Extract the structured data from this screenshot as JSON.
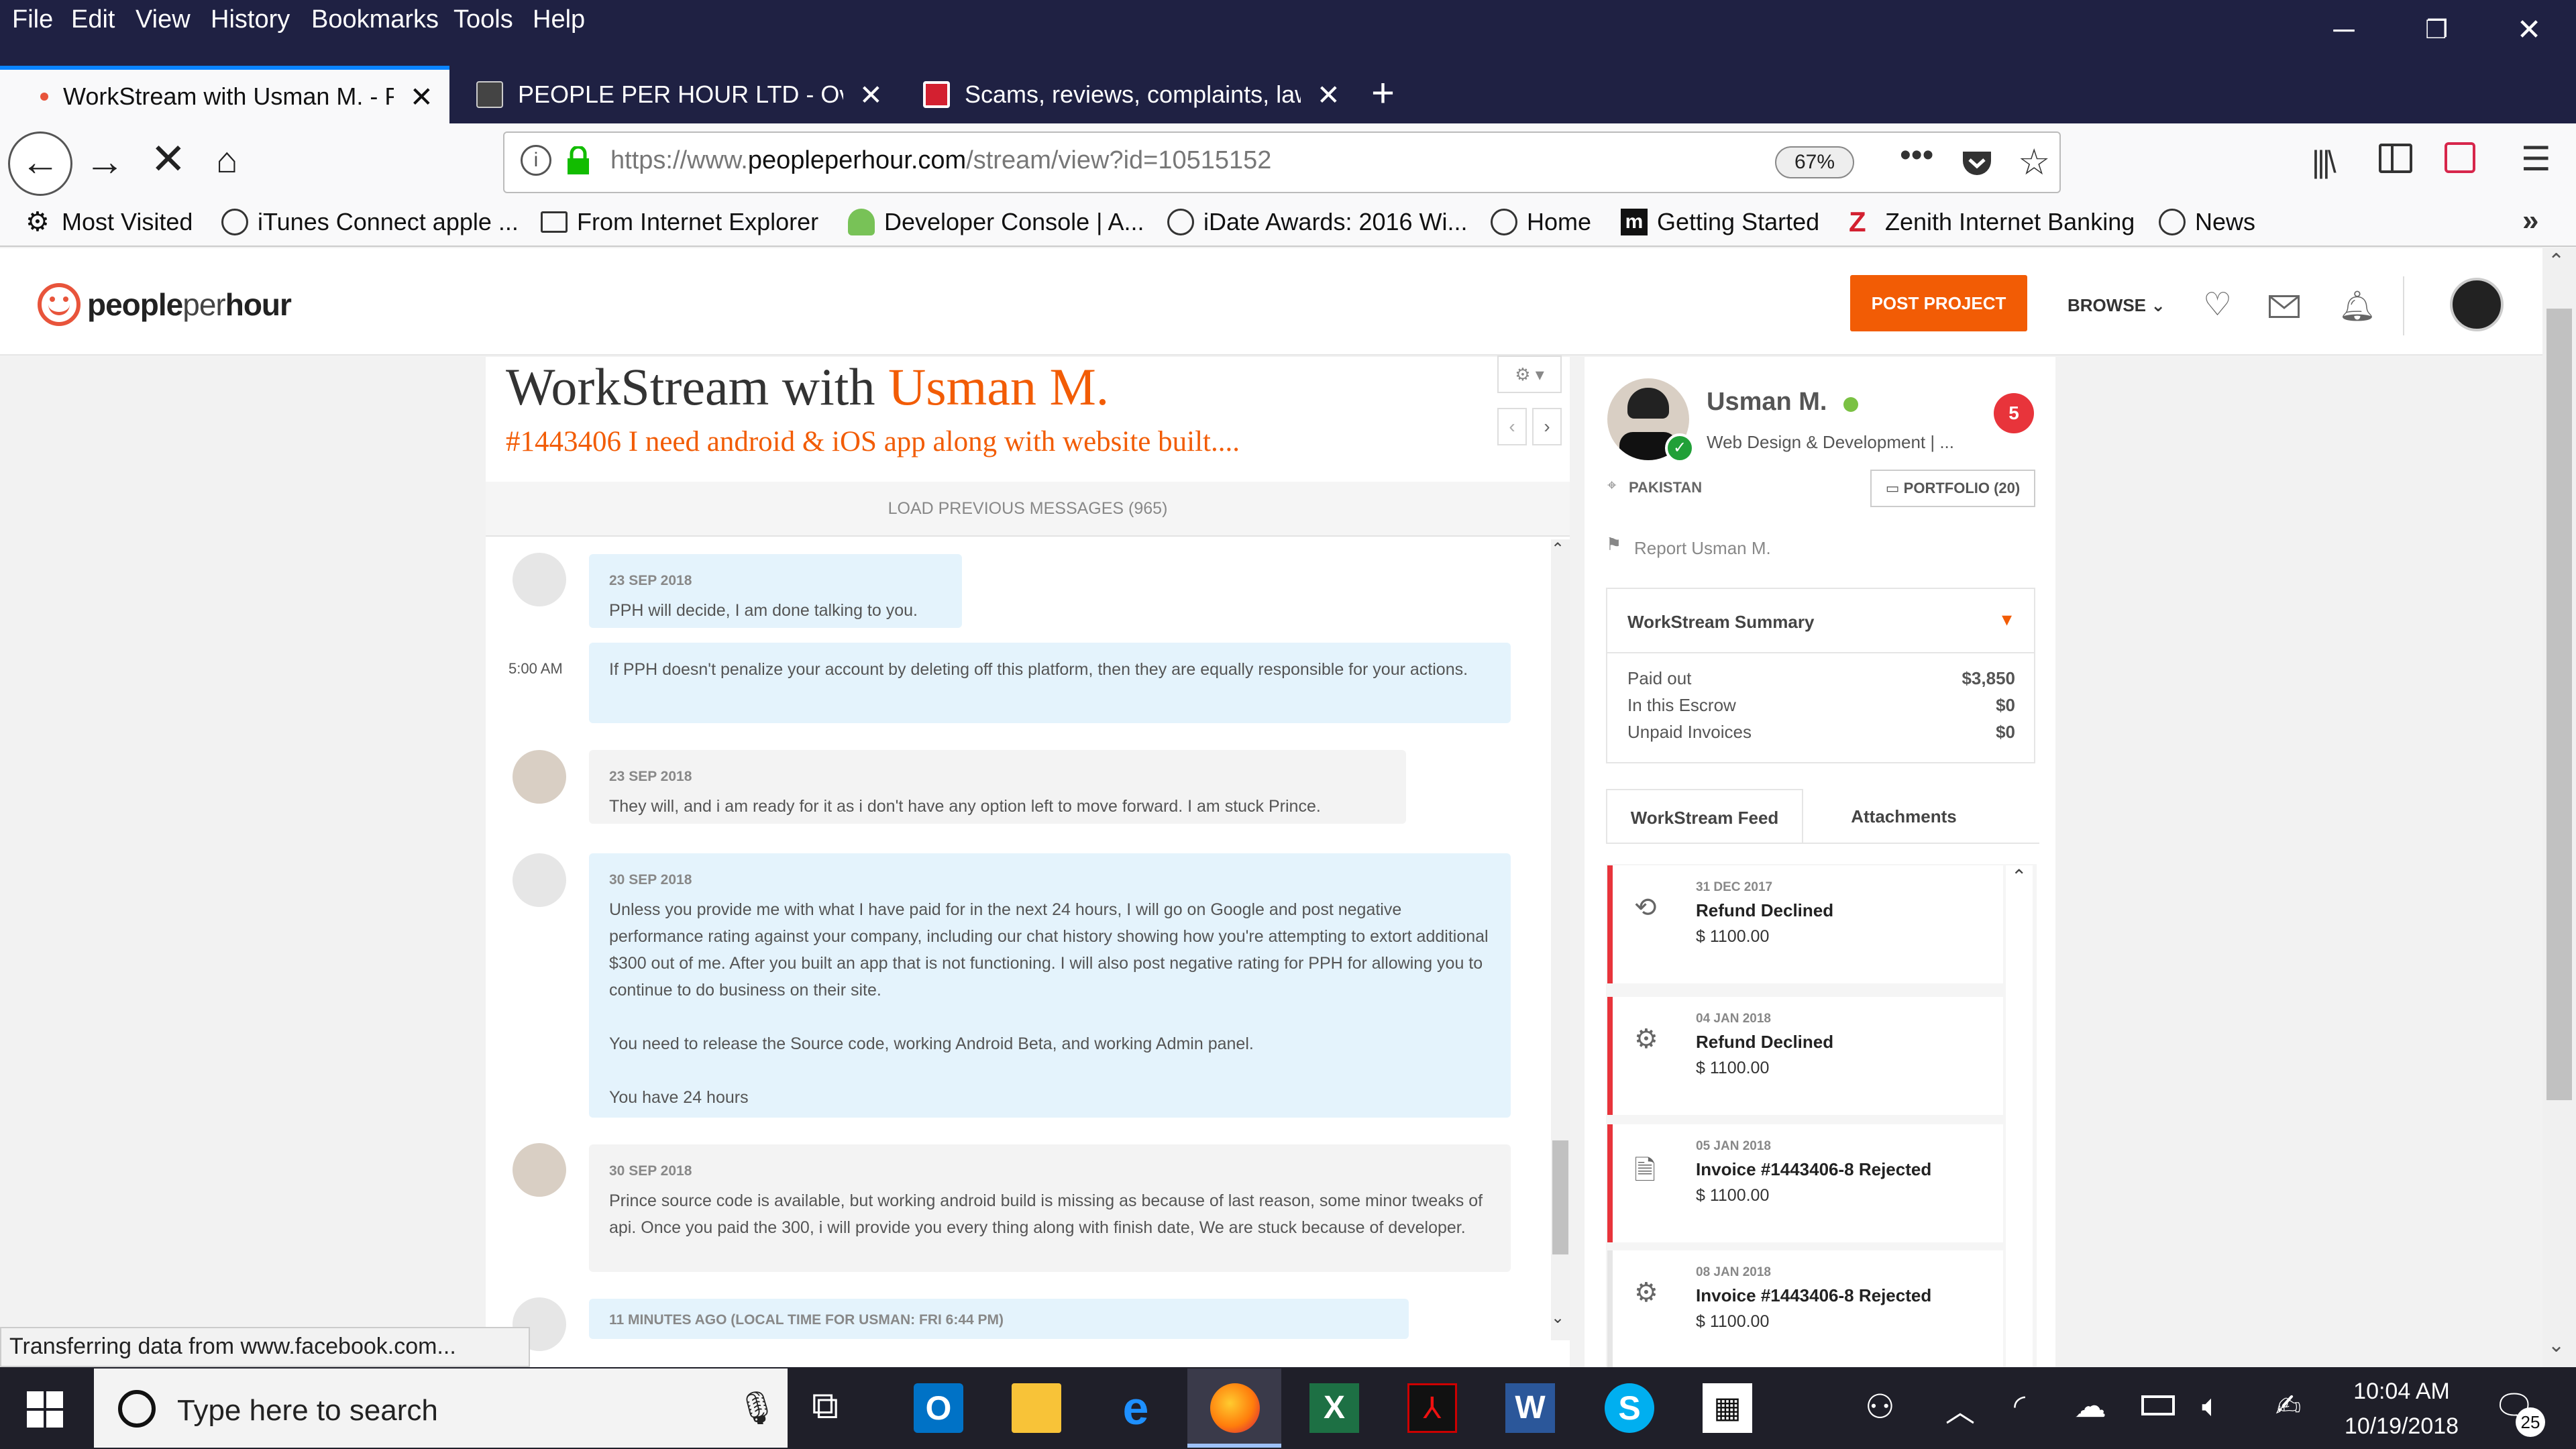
{
  "menu": [
    "File",
    "Edit",
    "View",
    "History",
    "Bookmarks",
    "Tools",
    "Help"
  ],
  "tabs": [
    {
      "title": "WorkStream with Usman M. - PeoplePerHour",
      "active": true
    },
    {
      "title": "PEOPLE PER HOUR LTD - Overview",
      "active": false
    },
    {
      "title": "Scams, reviews, complaints, lawsuits",
      "active": false
    }
  ],
  "url": {
    "prefix": "https://www.",
    "domain": "peopleperhour.com",
    "path": "/stream/view?id=10515152",
    "zoom": "67%"
  },
  "bookmarks": [
    "Most Visited",
    "iTunes Connect apple ...",
    "From Internet Explorer",
    "Developer Console | A...",
    "iDate Awards: 2016 Wi...",
    "Home",
    "Getting Started",
    "Zenith Internet Banking",
    "News"
  ],
  "header": {
    "logo_a": "people",
    "logo_b": "per",
    "logo_c": "hour",
    "post_project": "POST PROJECT",
    "browse": "BROWSE"
  },
  "stream": {
    "title_a": "WorkStream with ",
    "title_b": "Usman M.",
    "subtitle": "#1443406 I need android & iOS app along with website built....",
    "load_previous": "LOAD PREVIOUS MESSAGES (965)",
    "messages": [
      {
        "date": "23 SEP 2018",
        "text": "PPH will decide, I am done talking to you."
      },
      {
        "time": "5:00 AM",
        "text": "If PPH doesn't penalize your account by deleting off this platform, then they are equally responsible for your actions."
      },
      {
        "date": "23 SEP 2018",
        "text": "They will, and i am ready for it as i don't have any option left to move forward. I am stuck Prince."
      },
      {
        "date": "30 SEP 2018",
        "text": "Unless you provide me with what I have paid for in the next 24 hours, I will go on Google and post negative performance rating against your company, including our chat history showing how you're attempting to extort additional $300 out of me. After you built an app that is not functioning. I will also post negative rating for PPH for allowing you to continue to do business on their site.",
        "text2": "You need to release the Source code, working Android Beta, and working Admin panel.",
        "text3": "You have 24 hours"
      },
      {
        "date": "30 SEP 2018",
        "text": "Prince source code is available, but working android build is missing as because of last reason, some minor tweaks of api. Once you paid the 300, i will provide you every thing along with finish date, We are stuck because of developer."
      },
      {
        "date": "11 MINUTES AGO (LOCAL TIME FOR USMAN: FRI 6:44 PM)"
      }
    ]
  },
  "profile": {
    "name": "Usman M.",
    "category": "Web Design & Development | ...",
    "country": "PAKISTAN",
    "portfolio": "PORTFOLIO (20)",
    "report": "Report Usman M.",
    "badge": "5"
  },
  "summary": {
    "title": "WorkStream Summary",
    "rows": [
      {
        "label": "Paid out",
        "value": "$3,850"
      },
      {
        "label": "In this Escrow",
        "value": "$0"
      },
      {
        "label": "Unpaid Invoices",
        "value": "$0"
      }
    ]
  },
  "feed": {
    "tabs": [
      "WorkStream Feed",
      "Attachments"
    ],
    "items": [
      {
        "date": "31 DEC 2017",
        "title": "Refund Declined",
        "amount": "$ 1100.00",
        "icon": "history-icon"
      },
      {
        "date": "04 JAN 2018",
        "title": "Refund Declined",
        "amount": "$ 1100.00",
        "icon": "gears-icon"
      },
      {
        "date": "05 JAN 2018",
        "title": "Invoice #1443406-8 Rejected",
        "amount": "$ 1100.00",
        "icon": "document-icon"
      },
      {
        "date": "08 JAN 2018",
        "title": "Invoice #1443406-8 Rejected",
        "amount": "$ 1100.00",
        "icon": "gears-icon"
      }
    ]
  },
  "status": "Transferring data from www.facebook.com...",
  "taskbar": {
    "search": "Type here to search",
    "time": "10:04 AM",
    "date": "10/19/2018",
    "notifications": "25"
  }
}
